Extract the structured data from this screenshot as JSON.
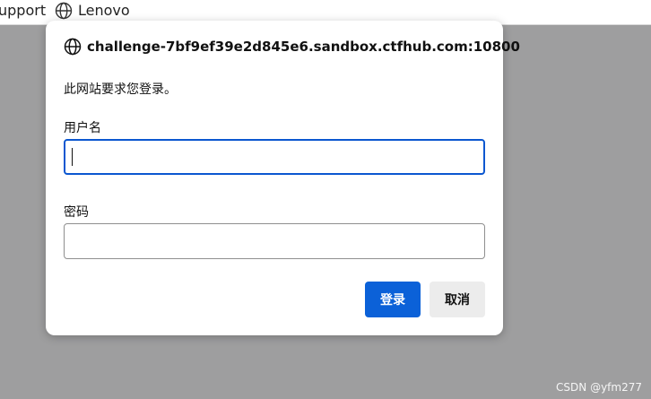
{
  "bookmarks": [
    {
      "label": "upport"
    },
    {
      "label": "Lenovo",
      "icon": "globe-icon"
    }
  ],
  "dialog": {
    "title": "challenge-7bf9ef39e2d845e6.sandbox.ctfhub.com:10800",
    "title_icon": "globe-icon",
    "message": "此网站要求您登录。",
    "username_label": "用户名",
    "username_value": "",
    "password_label": "密码",
    "password_value": "",
    "login_button": "登录",
    "cancel_button": "取消"
  },
  "watermark": "CSDN @yfm277",
  "colors": {
    "backdrop": "#9e9e9f",
    "primary_button": "#0b61d8",
    "focus_border": "#0b57d0",
    "secondary_button": "#ececec"
  }
}
